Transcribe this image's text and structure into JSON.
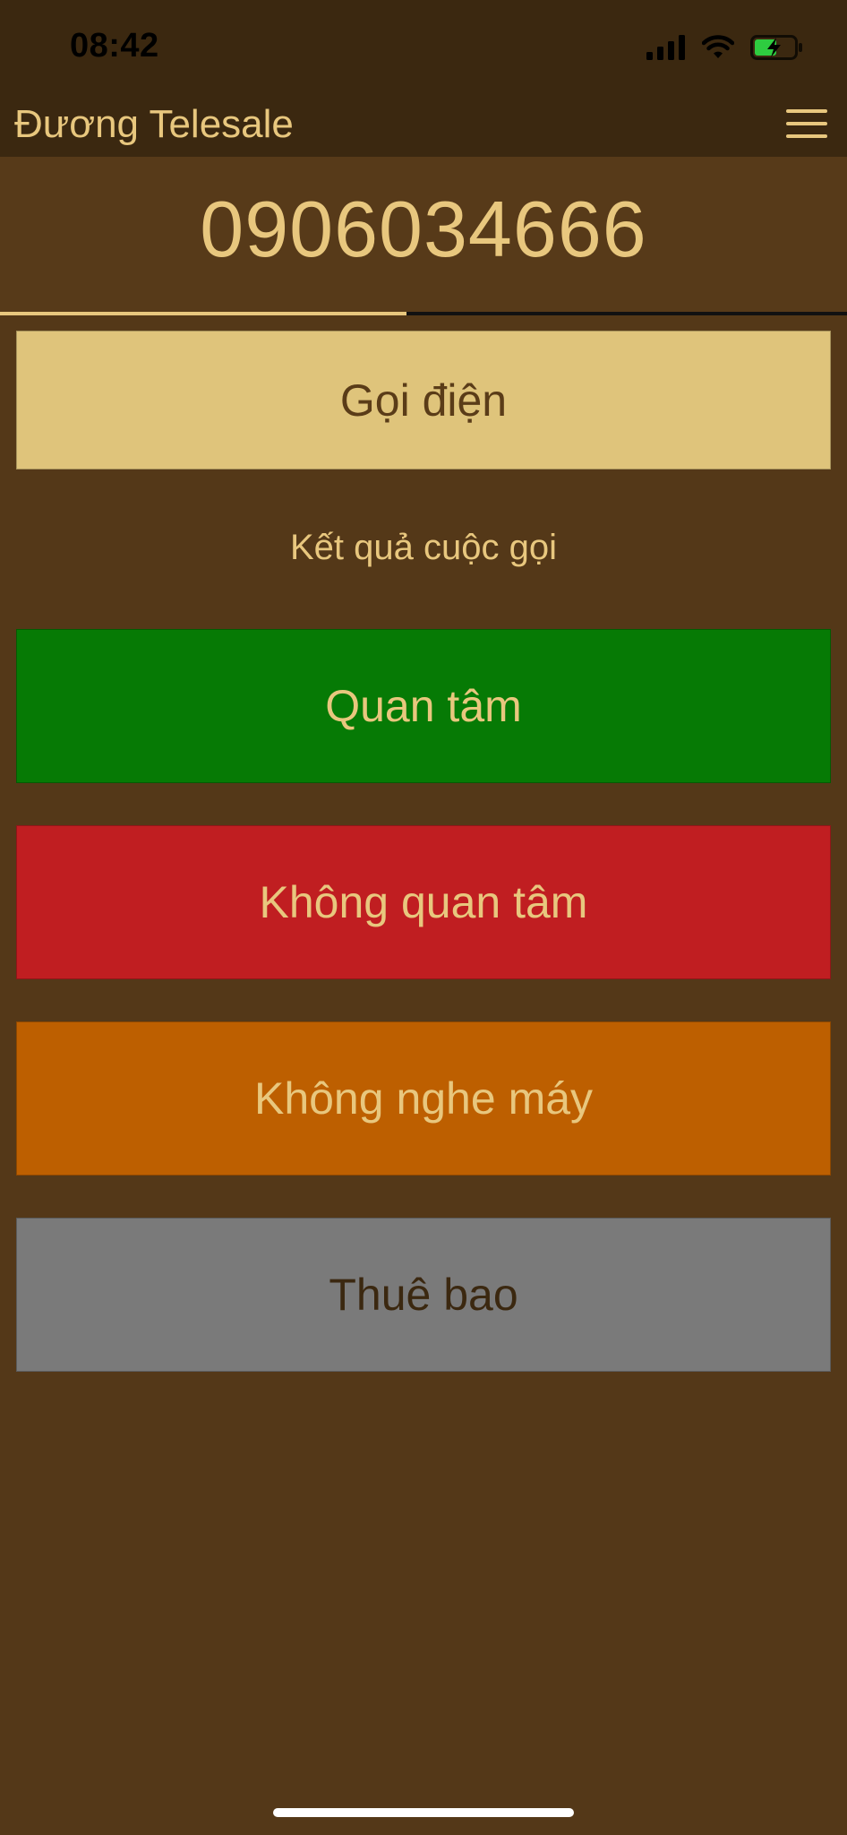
{
  "status_bar": {
    "time": "08:42",
    "icons": [
      "cellular-signal-icon",
      "wifi-icon",
      "battery-charging-icon"
    ]
  },
  "header": {
    "title": "Đương Telesale",
    "menu_icon": "hamburger-menu-icon"
  },
  "contact": {
    "phone_number": "0906034666"
  },
  "progress": {
    "fraction": 0.48
  },
  "actions": {
    "call_label": "Gọi điện",
    "result_heading": "Kết quả cuộc gọi",
    "interested_label": "Quan tâm",
    "not_interested_label": "Không quan tâm",
    "no_answer_label": "Không nghe máy",
    "subscriber_label": "Thuê bao"
  },
  "colors": {
    "background": "#543818",
    "header": "#3b2810",
    "accent": "#e8c77e",
    "call_button": "#dfc47b",
    "interested": "#067a05",
    "not_interested": "#c01e21",
    "no_answer": "#bd5f00",
    "subscriber": "#7a7a7a"
  }
}
